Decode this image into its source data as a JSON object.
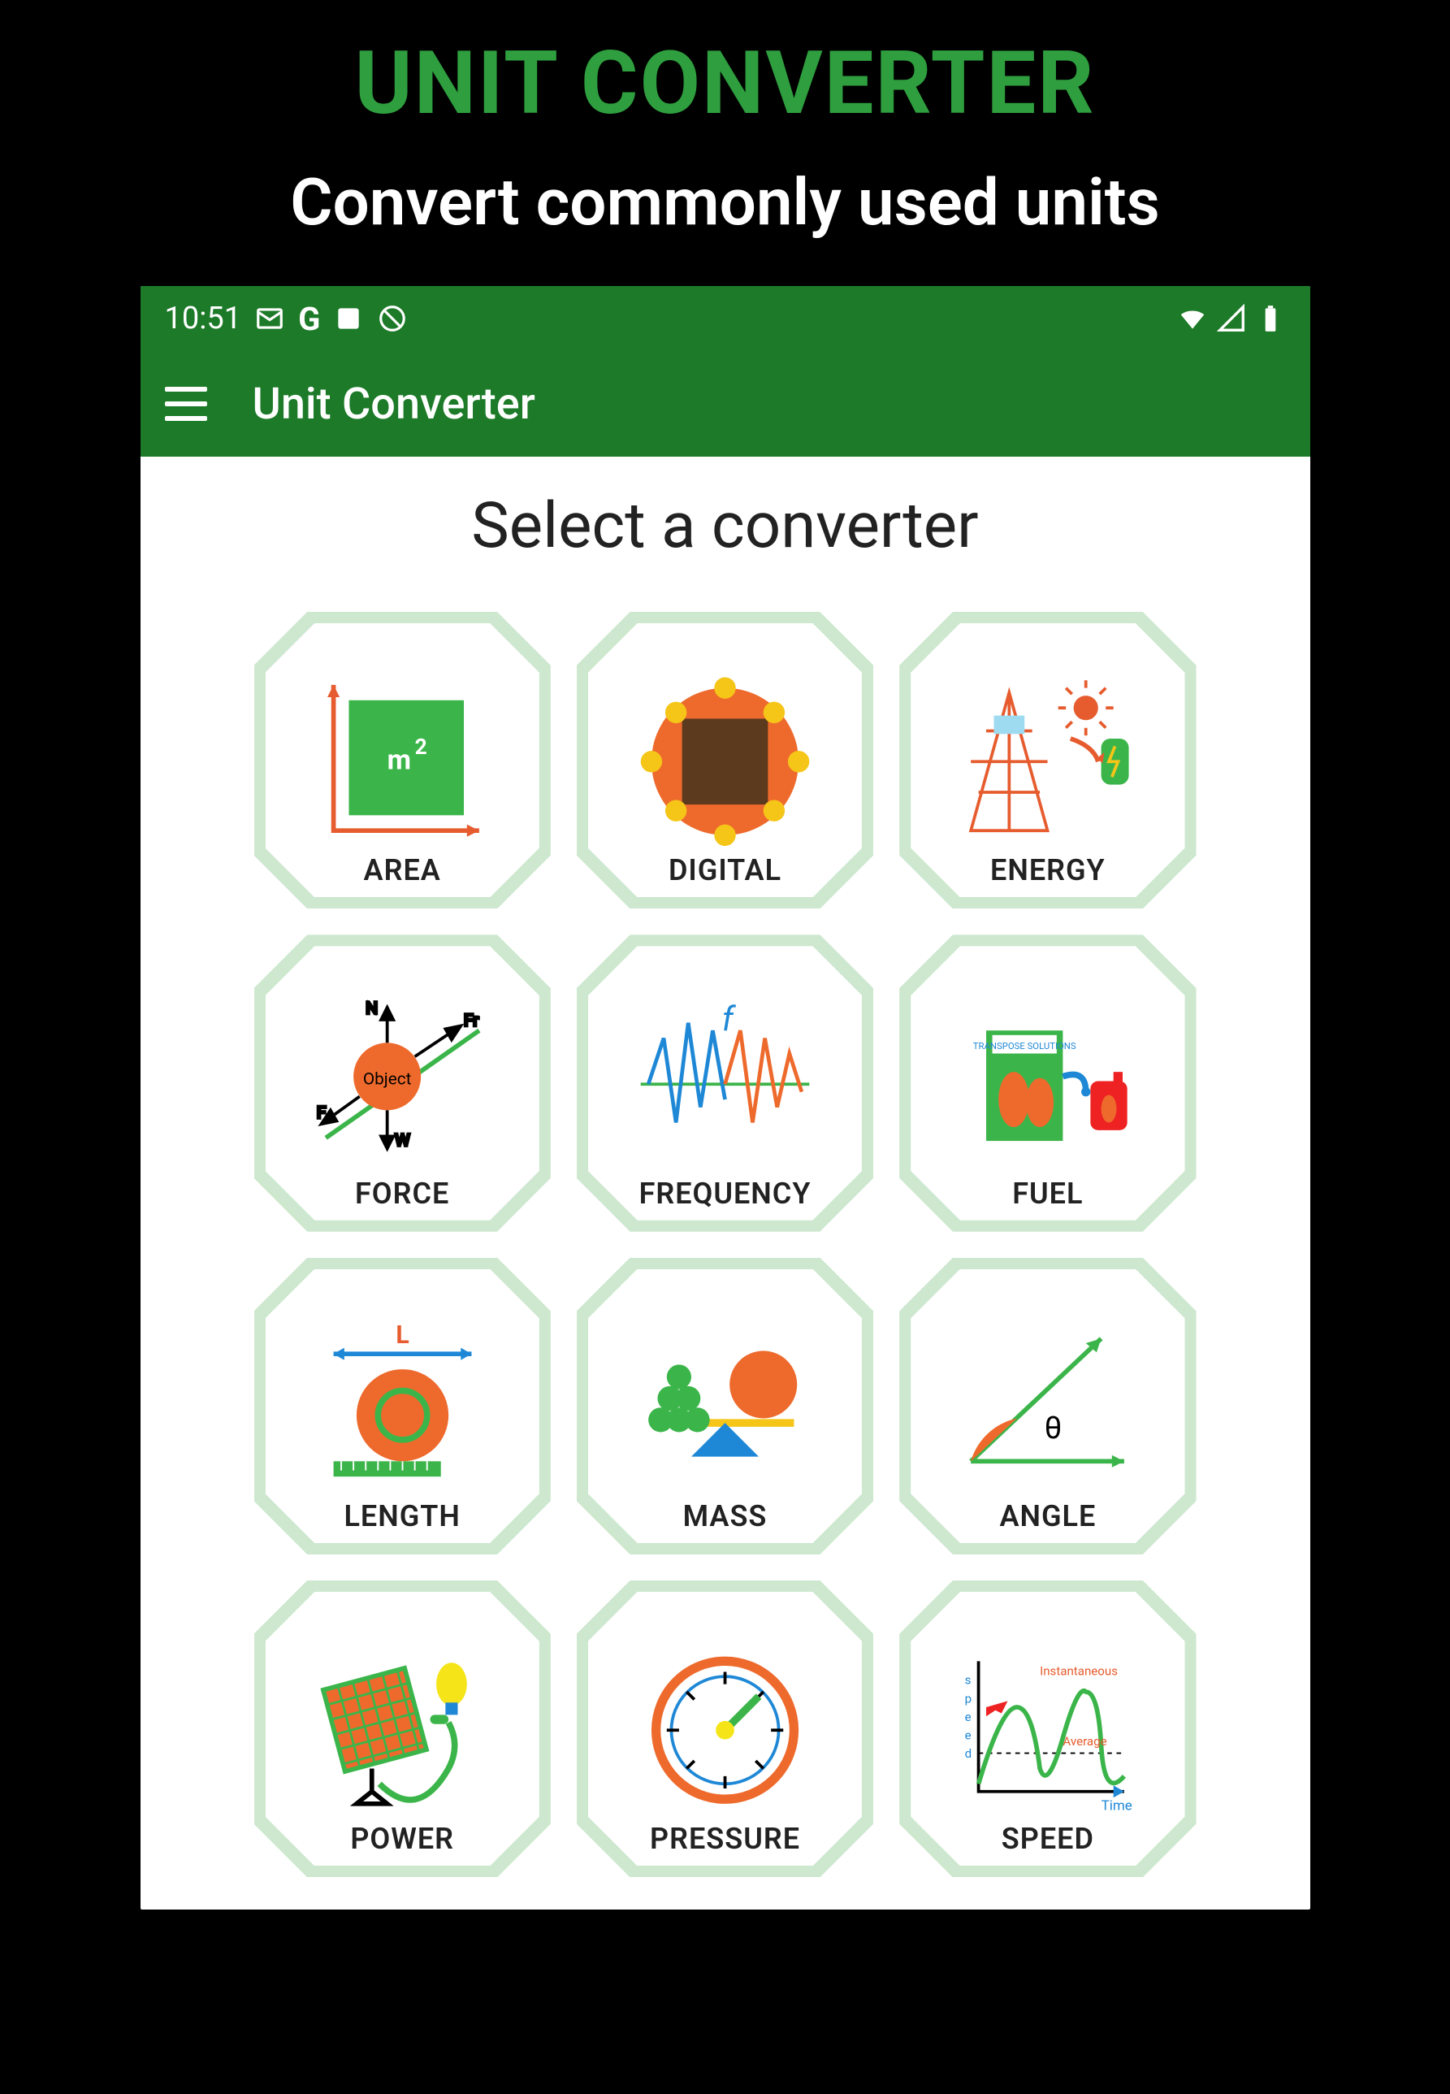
{
  "promo": {
    "title": "UNIT CONVERTER",
    "subtitle": "Convert commonly used units"
  },
  "status": {
    "time": "10:51",
    "icons_left": [
      "mail-icon",
      "g-icon",
      "screenshot-icon",
      "target-icon"
    ],
    "icons_right": [
      "wifi-icon",
      "signal-icon",
      "battery-icon"
    ]
  },
  "appbar": {
    "title": "Unit Converter"
  },
  "page": {
    "title": "Select a converter"
  },
  "tiles": [
    {
      "id": "area",
      "label": "AREA",
      "icon": "area-icon"
    },
    {
      "id": "digital",
      "label": "DIGITAL",
      "icon": "digital-icon"
    },
    {
      "id": "energy",
      "label": "ENERGY",
      "icon": "energy-icon"
    },
    {
      "id": "force",
      "label": "FORCE",
      "icon": "force-icon"
    },
    {
      "id": "frequency",
      "label": "FREQUENCY",
      "icon": "frequency-icon"
    },
    {
      "id": "fuel",
      "label": "FUEL",
      "icon": "fuel-icon"
    },
    {
      "id": "length",
      "label": "LENGTH",
      "icon": "length-icon"
    },
    {
      "id": "mass",
      "label": "MASS",
      "icon": "mass-icon"
    },
    {
      "id": "angle",
      "label": "ANGLE",
      "icon": "angle-icon"
    },
    {
      "id": "power",
      "label": "POWER",
      "icon": "power-icon"
    },
    {
      "id": "pressure",
      "label": "PRESSURE",
      "icon": "pressure-icon"
    },
    {
      "id": "speed",
      "label": "SPEED",
      "icon": "speed-icon"
    }
  ],
  "colors": {
    "brand_green": "#1C7A28",
    "promo_green": "#2E9E3E",
    "tile_border": "#CDE8CF"
  }
}
